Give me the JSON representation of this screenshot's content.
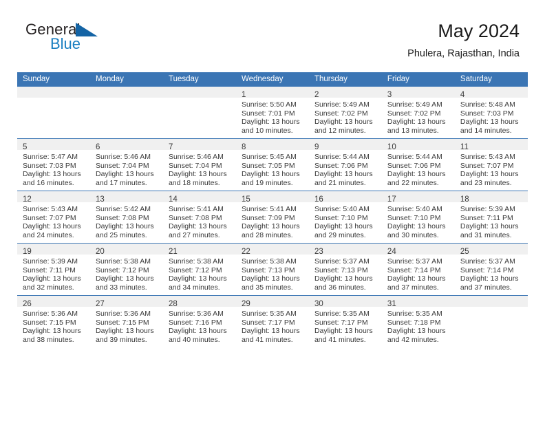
{
  "brand": {
    "line1": "General",
    "line2": "Blue",
    "triangle_color": "#1464a5",
    "blue_text_color": "#1a7fc1"
  },
  "header": {
    "title": "May 2024",
    "location": "Phulera, Rajasthan, India"
  },
  "theme": {
    "header_blue": "#3b75b4",
    "band_gray": "#f0f0f0",
    "text": "#3a3a3a"
  },
  "weekday_headers": [
    "Sunday",
    "Monday",
    "Tuesday",
    "Wednesday",
    "Thursday",
    "Friday",
    "Saturday"
  ],
  "weeks": [
    [
      {
        "day": "",
        "lines": []
      },
      {
        "day": "",
        "lines": []
      },
      {
        "day": "",
        "lines": []
      },
      {
        "day": "1",
        "lines": [
          "Sunrise: 5:50 AM",
          "Sunset: 7:01 PM",
          "Daylight: 13 hours",
          "and 10 minutes."
        ]
      },
      {
        "day": "2",
        "lines": [
          "Sunrise: 5:49 AM",
          "Sunset: 7:02 PM",
          "Daylight: 13 hours",
          "and 12 minutes."
        ]
      },
      {
        "day": "3",
        "lines": [
          "Sunrise: 5:49 AM",
          "Sunset: 7:02 PM",
          "Daylight: 13 hours",
          "and 13 minutes."
        ]
      },
      {
        "day": "4",
        "lines": [
          "Sunrise: 5:48 AM",
          "Sunset: 7:03 PM",
          "Daylight: 13 hours",
          "and 14 minutes."
        ]
      }
    ],
    [
      {
        "day": "5",
        "lines": [
          "Sunrise: 5:47 AM",
          "Sunset: 7:03 PM",
          "Daylight: 13 hours",
          "and 16 minutes."
        ]
      },
      {
        "day": "6",
        "lines": [
          "Sunrise: 5:46 AM",
          "Sunset: 7:04 PM",
          "Daylight: 13 hours",
          "and 17 minutes."
        ]
      },
      {
        "day": "7",
        "lines": [
          "Sunrise: 5:46 AM",
          "Sunset: 7:04 PM",
          "Daylight: 13 hours",
          "and 18 minutes."
        ]
      },
      {
        "day": "8",
        "lines": [
          "Sunrise: 5:45 AM",
          "Sunset: 7:05 PM",
          "Daylight: 13 hours",
          "and 19 minutes."
        ]
      },
      {
        "day": "9",
        "lines": [
          "Sunrise: 5:44 AM",
          "Sunset: 7:06 PM",
          "Daylight: 13 hours",
          "and 21 minutes."
        ]
      },
      {
        "day": "10",
        "lines": [
          "Sunrise: 5:44 AM",
          "Sunset: 7:06 PM",
          "Daylight: 13 hours",
          "and 22 minutes."
        ]
      },
      {
        "day": "11",
        "lines": [
          "Sunrise: 5:43 AM",
          "Sunset: 7:07 PM",
          "Daylight: 13 hours",
          "and 23 minutes."
        ]
      }
    ],
    [
      {
        "day": "12",
        "lines": [
          "Sunrise: 5:43 AM",
          "Sunset: 7:07 PM",
          "Daylight: 13 hours",
          "and 24 minutes."
        ]
      },
      {
        "day": "13",
        "lines": [
          "Sunrise: 5:42 AM",
          "Sunset: 7:08 PM",
          "Daylight: 13 hours",
          "and 25 minutes."
        ]
      },
      {
        "day": "14",
        "lines": [
          "Sunrise: 5:41 AM",
          "Sunset: 7:08 PM",
          "Daylight: 13 hours",
          "and 27 minutes."
        ]
      },
      {
        "day": "15",
        "lines": [
          "Sunrise: 5:41 AM",
          "Sunset: 7:09 PM",
          "Daylight: 13 hours",
          "and 28 minutes."
        ]
      },
      {
        "day": "16",
        "lines": [
          "Sunrise: 5:40 AM",
          "Sunset: 7:10 PM",
          "Daylight: 13 hours",
          "and 29 minutes."
        ]
      },
      {
        "day": "17",
        "lines": [
          "Sunrise: 5:40 AM",
          "Sunset: 7:10 PM",
          "Daylight: 13 hours",
          "and 30 minutes."
        ]
      },
      {
        "day": "18",
        "lines": [
          "Sunrise: 5:39 AM",
          "Sunset: 7:11 PM",
          "Daylight: 13 hours",
          "and 31 minutes."
        ]
      }
    ],
    [
      {
        "day": "19",
        "lines": [
          "Sunrise: 5:39 AM",
          "Sunset: 7:11 PM",
          "Daylight: 13 hours",
          "and 32 minutes."
        ]
      },
      {
        "day": "20",
        "lines": [
          "Sunrise: 5:38 AM",
          "Sunset: 7:12 PM",
          "Daylight: 13 hours",
          "and 33 minutes."
        ]
      },
      {
        "day": "21",
        "lines": [
          "Sunrise: 5:38 AM",
          "Sunset: 7:12 PM",
          "Daylight: 13 hours",
          "and 34 minutes."
        ]
      },
      {
        "day": "22",
        "lines": [
          "Sunrise: 5:38 AM",
          "Sunset: 7:13 PM",
          "Daylight: 13 hours",
          "and 35 minutes."
        ]
      },
      {
        "day": "23",
        "lines": [
          "Sunrise: 5:37 AM",
          "Sunset: 7:13 PM",
          "Daylight: 13 hours",
          "and 36 minutes."
        ]
      },
      {
        "day": "24",
        "lines": [
          "Sunrise: 5:37 AM",
          "Sunset: 7:14 PM",
          "Daylight: 13 hours",
          "and 37 minutes."
        ]
      },
      {
        "day": "25",
        "lines": [
          "Sunrise: 5:37 AM",
          "Sunset: 7:14 PM",
          "Daylight: 13 hours",
          "and 37 minutes."
        ]
      }
    ],
    [
      {
        "day": "26",
        "lines": [
          "Sunrise: 5:36 AM",
          "Sunset: 7:15 PM",
          "Daylight: 13 hours",
          "and 38 minutes."
        ]
      },
      {
        "day": "27",
        "lines": [
          "Sunrise: 5:36 AM",
          "Sunset: 7:15 PM",
          "Daylight: 13 hours",
          "and 39 minutes."
        ]
      },
      {
        "day": "28",
        "lines": [
          "Sunrise: 5:36 AM",
          "Sunset: 7:16 PM",
          "Daylight: 13 hours",
          "and 40 minutes."
        ]
      },
      {
        "day": "29",
        "lines": [
          "Sunrise: 5:35 AM",
          "Sunset: 7:17 PM",
          "Daylight: 13 hours",
          "and 41 minutes."
        ]
      },
      {
        "day": "30",
        "lines": [
          "Sunrise: 5:35 AM",
          "Sunset: 7:17 PM",
          "Daylight: 13 hours",
          "and 41 minutes."
        ]
      },
      {
        "day": "31",
        "lines": [
          "Sunrise: 5:35 AM",
          "Sunset: 7:18 PM",
          "Daylight: 13 hours",
          "and 42 minutes."
        ]
      },
      {
        "day": "",
        "lines": []
      }
    ]
  ]
}
